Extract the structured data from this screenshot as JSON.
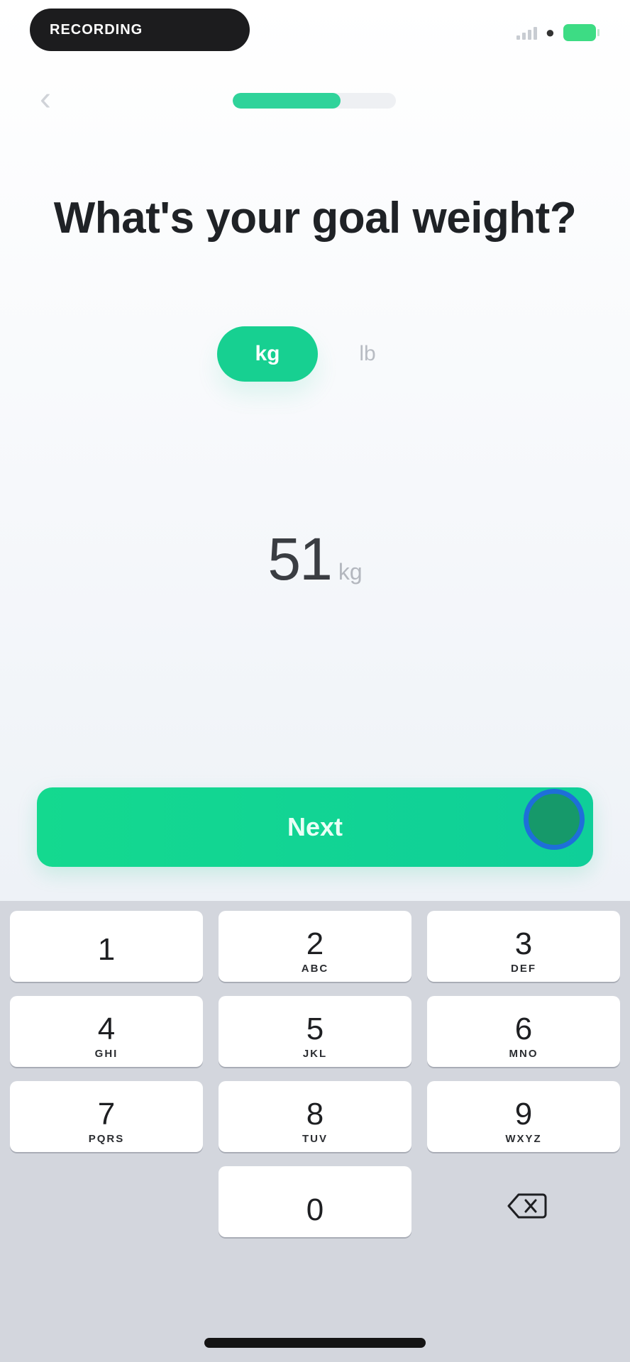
{
  "status_bar": {
    "pill_text": "RECORDING",
    "battery_color": "#3ddc84"
  },
  "nav": {
    "back_icon": "chevron-left-icon",
    "progress_fraction": 0.66
  },
  "screen": {
    "title": "What's your goal weight?"
  },
  "unit_toggle": {
    "active": "kg",
    "inactive": "lb"
  },
  "weight": {
    "value": "51",
    "unit": "kg"
  },
  "next_button": {
    "label": "Next"
  },
  "keyboard": {
    "keys": [
      {
        "digit": "1",
        "letters": ""
      },
      {
        "digit": "2",
        "letters": "ABC"
      },
      {
        "digit": "3",
        "letters": "DEF"
      },
      {
        "digit": "4",
        "letters": "GHI"
      },
      {
        "digit": "5",
        "letters": "JKL"
      },
      {
        "digit": "6",
        "letters": "MNO"
      },
      {
        "digit": "7",
        "letters": "PQRS"
      },
      {
        "digit": "8",
        "letters": "TUV"
      },
      {
        "digit": "9",
        "letters": "WXYZ"
      },
      {
        "digit": "0",
        "letters": ""
      }
    ],
    "delete_icon": "backspace-icon"
  },
  "colors": {
    "accent": "#17d091",
    "title": "#1f2226",
    "keyboard_bg": "#d3d6dd"
  }
}
